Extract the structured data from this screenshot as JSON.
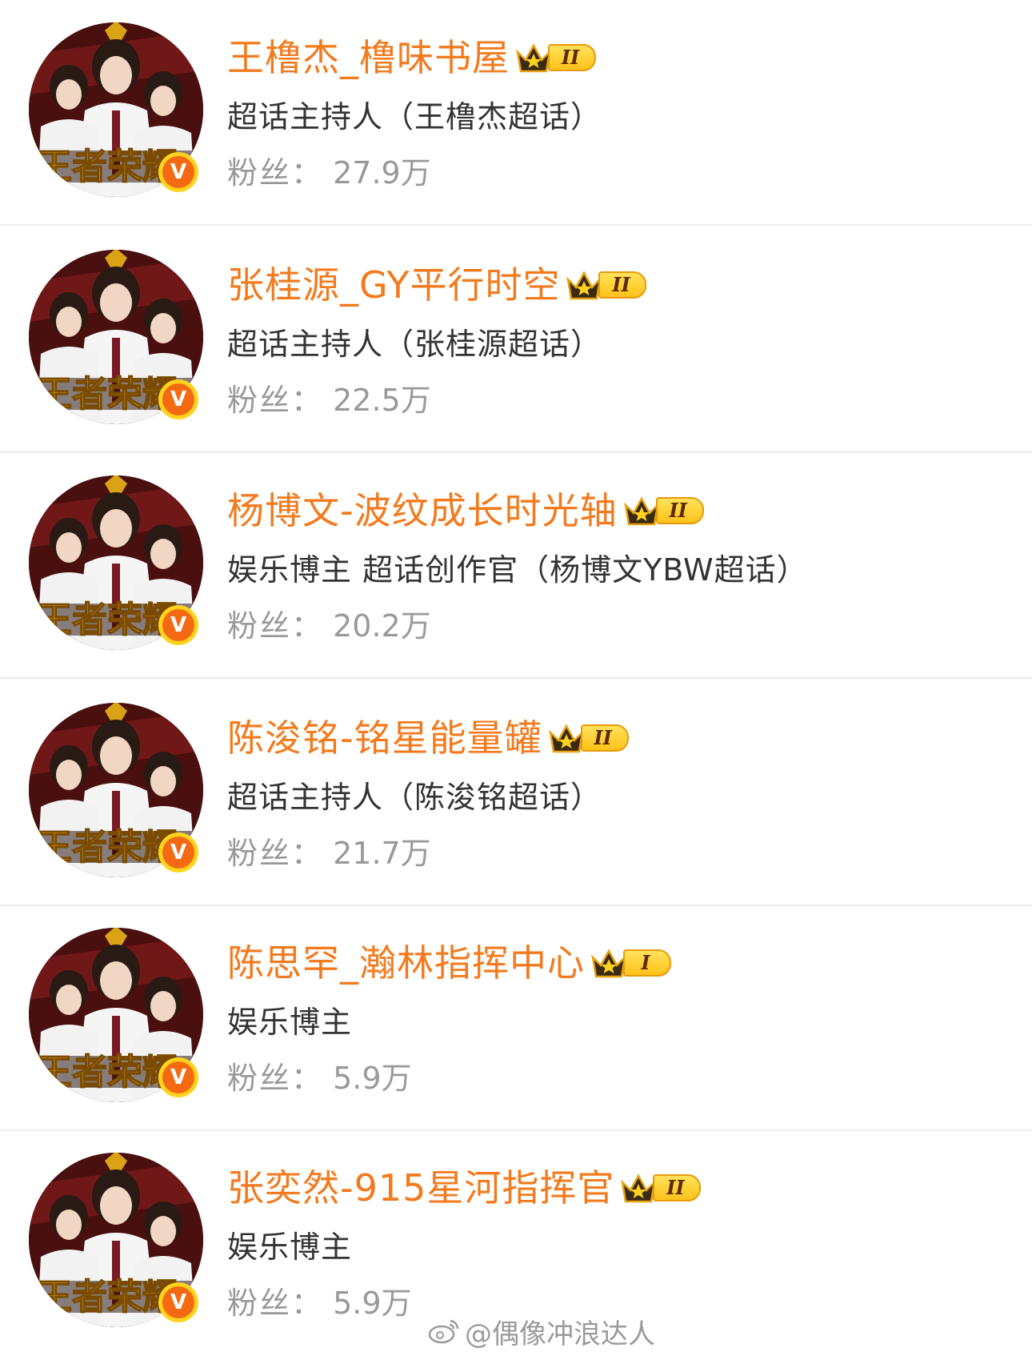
{
  "accounts": [
    {
      "name": "王橹杰_橹味书屋",
      "rank": "II",
      "role": "超话主持人（王橹杰超话）",
      "fans_label": "粉丝：",
      "fans": "27.9万"
    },
    {
      "name": "张桂源_GY平行时空",
      "rank": "II",
      "role": "超话主持人（张桂源超话）",
      "fans_label": "粉丝：",
      "fans": "22.5万"
    },
    {
      "name": "杨博文-波纹成长时光轴",
      "rank": "II",
      "role": "娱乐博主 超话创作官（杨博文YBW超话）",
      "fans_label": "粉丝：",
      "fans": "20.2万"
    },
    {
      "name": "陈浚铭-铭星能量罐",
      "rank": "II",
      "role": "超话主持人（陈浚铭超话）",
      "fans_label": "粉丝：",
      "fans": "21.7万"
    },
    {
      "name": "陈思罕_瀚林指挥中心",
      "rank": "I",
      "role": "娱乐博主",
      "fans_label": "粉丝：",
      "fans": "5.9万"
    },
    {
      "name": "张奕然-915星河指挥官",
      "rank": "II",
      "role": "娱乐博主",
      "fans_label": "粉丝：",
      "fans": "5.9万"
    }
  ],
  "verified_badge": "V",
  "watermark": "@偶像冲浪达人",
  "icons": {
    "verified": "v-badge-icon",
    "crown": "crown-icon",
    "weibo": "weibo-icon"
  },
  "colors": {
    "name": "#f37a1d",
    "role": "#333333",
    "fans": "#999999",
    "badge_orange": "#f36a12",
    "badge_yellow": "#ffd21e"
  }
}
